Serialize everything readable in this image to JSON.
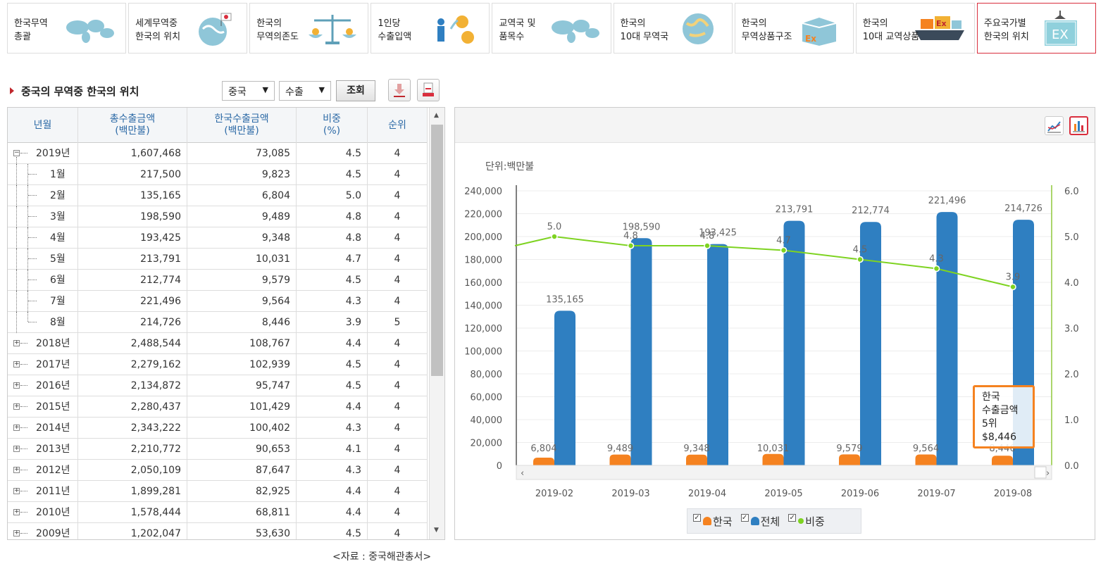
{
  "tabs": [
    {
      "label": "한국무역\n총괄",
      "icon": "world-map-icon",
      "active": false
    },
    {
      "label": "세계무역중\n한국의 위치",
      "icon": "globe-korea-flag-icon",
      "active": false
    },
    {
      "label": "한국의\n무역의존도",
      "icon": "balance-scale-icon",
      "active": false
    },
    {
      "label": "1인당\n수출입액",
      "icon": "person-currency-icon",
      "active": false
    },
    {
      "label": "교역국 및\n품목수",
      "icon": "world-map-icon",
      "active": false
    },
    {
      "label": "한국의\n10대 무역국",
      "icon": "globe-icon",
      "active": false
    },
    {
      "label": "한국의\n무역상품구조",
      "icon": "export-box-icon",
      "active": false
    },
    {
      "label": "한국의\n10대 교역상품",
      "icon": "cargo-ship-icon",
      "active": false
    },
    {
      "label": "주요국가별\n한국의 위치",
      "icon": "container-crane-icon",
      "active": true
    }
  ],
  "section_title": "중국의 무역중 한국의 위치",
  "filters": {
    "country": "중국",
    "type": "수출",
    "query_button": "조회"
  },
  "table": {
    "headers": [
      "년월",
      "총수출금액\n(백만불)",
      "한국수출금액\n(백만불)",
      "비중\n(%)",
      "순위"
    ],
    "rows": [
      {
        "label": "2019년",
        "level": 0,
        "expanded": true,
        "total": "1,607,468",
        "korea": "73,085",
        "share": "4.5",
        "rank": "4"
      },
      {
        "label": "1월",
        "level": 1,
        "total": "217,500",
        "korea": "9,823",
        "share": "4.5",
        "rank": "4"
      },
      {
        "label": "2월",
        "level": 1,
        "total": "135,165",
        "korea": "6,804",
        "share": "5.0",
        "rank": "4"
      },
      {
        "label": "3월",
        "level": 1,
        "total": "198,590",
        "korea": "9,489",
        "share": "4.8",
        "rank": "4"
      },
      {
        "label": "4월",
        "level": 1,
        "total": "193,425",
        "korea": "9,348",
        "share": "4.8",
        "rank": "4"
      },
      {
        "label": "5월",
        "level": 1,
        "total": "213,791",
        "korea": "10,031",
        "share": "4.7",
        "rank": "4"
      },
      {
        "label": "6월",
        "level": 1,
        "total": "212,774",
        "korea": "9,579",
        "share": "4.5",
        "rank": "4"
      },
      {
        "label": "7월",
        "level": 1,
        "total": "221,496",
        "korea": "9,564",
        "share": "4.3",
        "rank": "4"
      },
      {
        "label": "8월",
        "level": 1,
        "last": true,
        "total": "214,726",
        "korea": "8,446",
        "share": "3.9",
        "rank": "5"
      },
      {
        "label": "2018년",
        "level": 0,
        "expanded": false,
        "total": "2,488,544",
        "korea": "108,767",
        "share": "4.4",
        "rank": "4"
      },
      {
        "label": "2017년",
        "level": 0,
        "expanded": false,
        "total": "2,279,162",
        "korea": "102,939",
        "share": "4.5",
        "rank": "4"
      },
      {
        "label": "2016년",
        "level": 0,
        "expanded": false,
        "total": "2,134,872",
        "korea": "95,747",
        "share": "4.5",
        "rank": "4"
      },
      {
        "label": "2015년",
        "level": 0,
        "expanded": false,
        "total": "2,280,437",
        "korea": "101,429",
        "share": "4.4",
        "rank": "4"
      },
      {
        "label": "2014년",
        "level": 0,
        "expanded": false,
        "total": "2,343,222",
        "korea": "100,402",
        "share": "4.3",
        "rank": "4"
      },
      {
        "label": "2013년",
        "level": 0,
        "expanded": false,
        "total": "2,210,772",
        "korea": "90,653",
        "share": "4.1",
        "rank": "4"
      },
      {
        "label": "2012년",
        "level": 0,
        "expanded": false,
        "total": "2,050,109",
        "korea": "87,647",
        "share": "4.3",
        "rank": "4"
      },
      {
        "label": "2011년",
        "level": 0,
        "expanded": false,
        "total": "1,899,281",
        "korea": "82,925",
        "share": "4.4",
        "rank": "4"
      },
      {
        "label": "2010년",
        "level": 0,
        "expanded": false,
        "total": "1,578,444",
        "korea": "68,811",
        "share": "4.4",
        "rank": "4"
      },
      {
        "label": "2009년",
        "level": 0,
        "expanded": false,
        "total": "1,202,047",
        "korea": "53,630",
        "share": "4.5",
        "rank": "4"
      }
    ]
  },
  "source": "<자료 : 중국해관총서>",
  "chart_data": {
    "type": "bar",
    "unit_label": "단위:백만불",
    "categories": [
      "2019-02",
      "2019-03",
      "2019-04",
      "2019-05",
      "2019-06",
      "2019-07",
      "2019-08"
    ],
    "series": [
      {
        "name": "한국",
        "color": "#f58220",
        "values": [
          6804,
          9489,
          9348,
          10031,
          9579,
          9564,
          8446
        ],
        "labels": [
          "6,804",
          "9,489",
          "9,348",
          "10,031",
          "9,579",
          "9,564",
          "8,446"
        ]
      },
      {
        "name": "전체",
        "color": "#2f7fc1",
        "values": [
          135165,
          198590,
          193425,
          213791,
          212774,
          221496,
          214726
        ],
        "labels": [
          "135,165",
          "198,590",
          "193,425",
          "213,791",
          "212,774",
          "221,496",
          "214,726"
        ]
      },
      {
        "name": "비중",
        "color": "#7ed321",
        "type": "line",
        "axis": "right",
        "values": [
          5.0,
          4.8,
          4.8,
          4.7,
          4.5,
          4.3,
          3.9
        ],
        "labels": [
          "5.0",
          "4.8",
          "4.8",
          "4.7",
          "4.5",
          "4.3",
          "3.9"
        ]
      }
    ],
    "y_left": {
      "min": 0,
      "max": 240000,
      "ticks": [
        "0",
        "20,000",
        "40,000",
        "60,000",
        "80,000",
        "100,000",
        "120,000",
        "140,000",
        "160,000",
        "180,000",
        "200,000",
        "220,000",
        "240,000"
      ]
    },
    "y_right": {
      "min": 0,
      "max": 6.0,
      "ticks": [
        "0.0",
        "1.0",
        "2.0",
        "3.0",
        "4.0",
        "5.0",
        "6.0"
      ]
    },
    "legend_position": "bottom",
    "grid": true
  },
  "tooltip": {
    "series": "한국",
    "metric": "수출금액",
    "rank": "5위",
    "value": "$8,446"
  }
}
